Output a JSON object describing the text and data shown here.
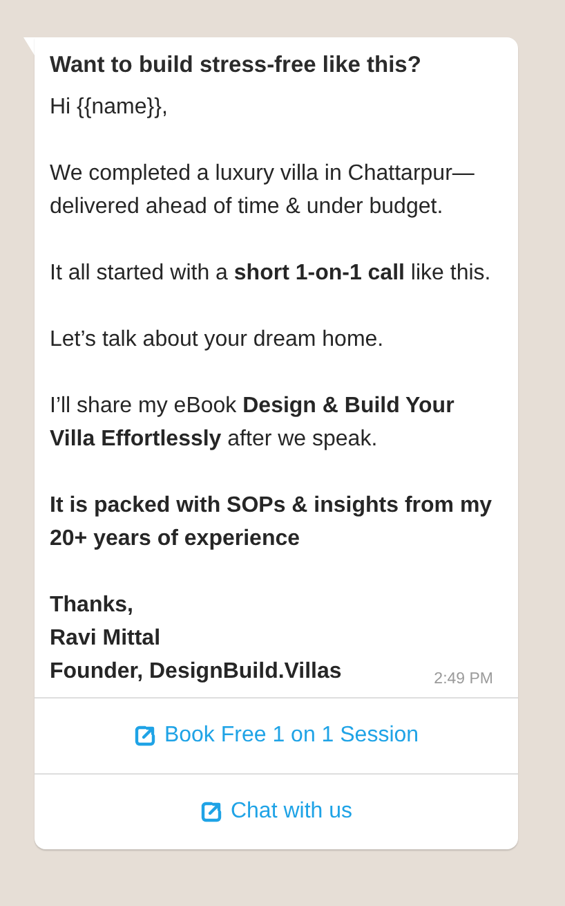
{
  "message": {
    "header": "Want to build stress-free like this?",
    "paragraphs": [
      {
        "text": "Hi {{name}},",
        "bold": false
      },
      {
        "text": "We completed a luxury villa in Chattarpur—delivered ahead of time & under budget.",
        "bold": false
      },
      {
        "text": "It all started with a **short 1-on-1 call** like this.",
        "bold": false
      },
      {
        "text": "Let’s talk about your dream home.",
        "bold": false
      },
      {
        "text": "I’ll share my eBook **Design & Build Your Villa Effortlessly** after we speak.",
        "bold": false
      },
      {
        "text": "It is packed with SOPs & insights from my 20+ years of experience",
        "bold": true
      },
      {
        "text": "Thanks,\nRavi Mittal\nFounder, DesignBuild.Villas",
        "bold": true
      }
    ],
    "time": "2:49 PM",
    "buttons": [
      {
        "label": "Book Free 1 on 1 Session",
        "kind": "link"
      },
      {
        "label": "Chat with us",
        "kind": "link"
      }
    ]
  }
}
